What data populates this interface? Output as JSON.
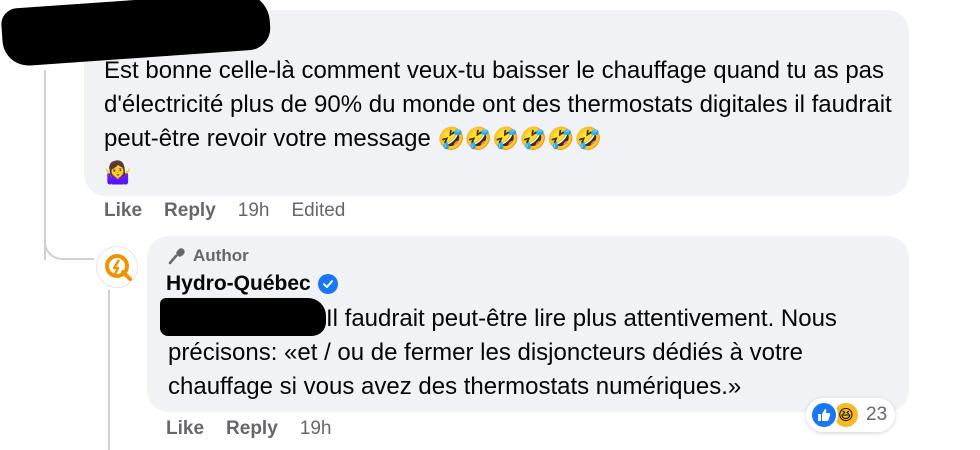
{
  "comment1": {
    "text": "Est bonne celle-là comment veux-tu baisser le chauffage quand tu as pas d'électricité plus de 90% du monde ont des thermostats digitales il faudrait peut-être revoir votre message",
    "emojis": "🤣🤣🤣🤣🤣🤣",
    "trailing_emoji": "🤷‍♀️",
    "actions": {
      "like": "Like",
      "reply": "Reply",
      "time": "19h",
      "edited": "Edited"
    }
  },
  "comment2": {
    "badge": "Author",
    "author": "Hydro-Québec",
    "text": "Il faudrait peut-être lire plus attentivement. Nous précisons: «et / ou de fermer les disjoncteurs dédiés à votre chauffage si vous avez des thermostats numériques.»",
    "actions": {
      "like": "Like",
      "reply": "Reply",
      "time": "19h"
    },
    "reactions": {
      "count": "23",
      "icons": [
        "like-icon",
        "haha-icon"
      ]
    }
  },
  "colors": {
    "bubble": "#f0f2f5",
    "meta": "#65676b",
    "verified": "#1877f2",
    "hydro_orange": "#f39200"
  }
}
